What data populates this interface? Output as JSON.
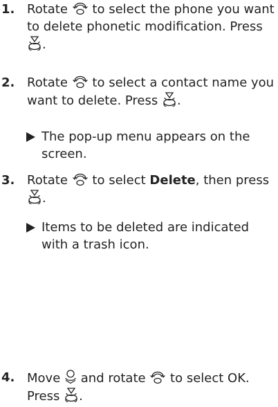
{
  "steps": [
    {
      "num": "1.",
      "t1": "Rotate",
      "t2": "to select the phone you want to delete phonetic modification. Press",
      "t3": "."
    },
    {
      "num": "2.",
      "t1": "Rotate",
      "t2": "to select a contact name you want to delete. Press",
      "t3": ".",
      "result": "The pop-up menu appears on the screen."
    },
    {
      "num": "3.",
      "t1": "Rotate",
      "t2": "to select",
      "bold": "Delete",
      "t3": ", then press",
      "t4": ".",
      "result": "Items to be deleted are indicated with a trash icon."
    },
    {
      "num": "4.",
      "t1": "Move",
      "t2": "and rotate",
      "t3": "to select OK. Press",
      "t4": "."
    }
  ],
  "icons": {
    "rotate": "rotate-knob-icon",
    "press": "press-knob-icon",
    "move": "move-stick-icon",
    "result": "result-arrow-icon"
  }
}
